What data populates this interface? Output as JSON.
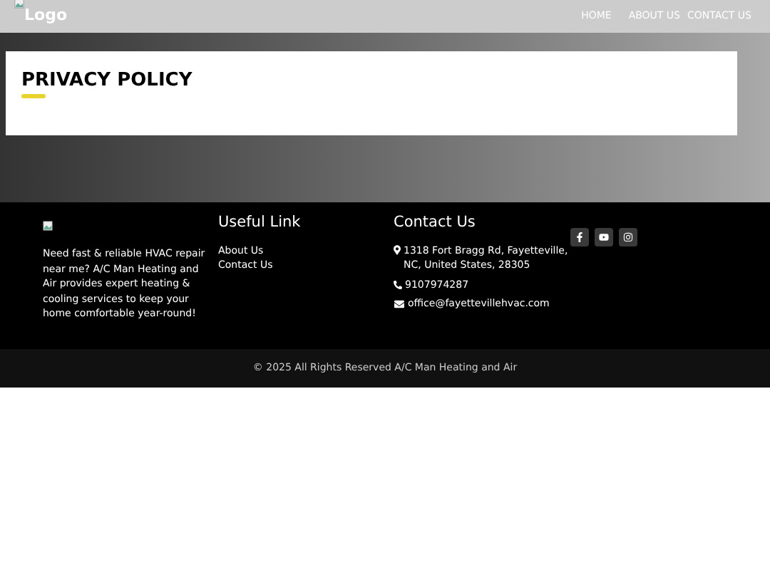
{
  "header": {
    "logo_alt": "Logo",
    "nav": [
      {
        "label": "HOME"
      },
      {
        "label": "ABOUT US"
      },
      {
        "label": "CONTACT US"
      }
    ]
  },
  "page_title": "PRIVACY POLICY",
  "footer": {
    "about": "Need fast & reliable HVAC repair near me? A/C Man Heating and Air provides expert heating & cooling services to keep your home comfortable year-round!",
    "useful_links": {
      "heading": "Useful Link",
      "links": [
        "About Us",
        "Contact Us"
      ]
    },
    "contact": {
      "heading": "Contact Us",
      "address": "1318 Fort Bragg Rd, Fayetteville, NC, United States, 28305",
      "phone": "9107974287",
      "email": "office@fayettevillehvac.com"
    },
    "social": [
      {
        "kind": "facebook"
      },
      {
        "kind": "youtube"
      },
      {
        "kind": "instagram"
      }
    ]
  },
  "copyright": "© 2025 All Rights Reserved A/C Man Heating and Air"
}
